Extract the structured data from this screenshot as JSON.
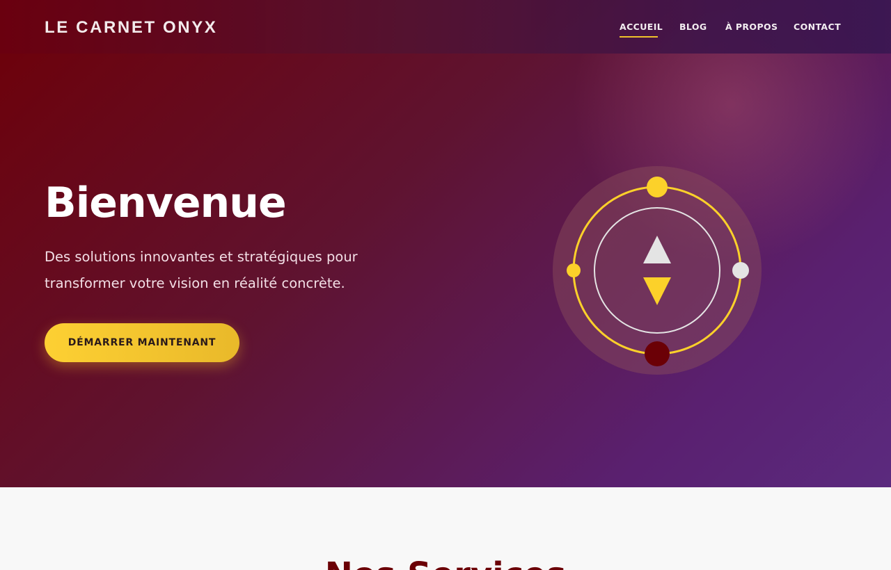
{
  "brand": {
    "name": "LE CARNET ONYX"
  },
  "nav": {
    "items": [
      {
        "label": "ACCUEIL",
        "active": true
      },
      {
        "label": "BLOG",
        "active": false
      },
      {
        "label": "À PROPOS",
        "active": false
      },
      {
        "label": "CONTACT",
        "active": false
      }
    ]
  },
  "hero": {
    "title": "Bienvenue",
    "subtitle": "Des solutions innovantes et stratégiques pour transformer votre vision en réalité concrète.",
    "cta_label": "DÉMARRER MAINTENANT"
  },
  "services": {
    "title": "Nos Services"
  },
  "colors": {
    "accent": "#fcd12a",
    "brand_dark_red": "#6b0006",
    "light_gray": "#e4e4e4",
    "section_background": "#f8f8f8"
  },
  "icons": {
    "emblem": "compass-emblem-icon",
    "up_arrow": "triangle-up-icon",
    "down_arrow": "triangle-down-icon"
  }
}
